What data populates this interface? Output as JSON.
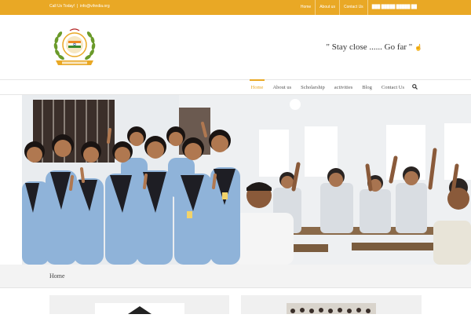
{
  "topbar": {
    "phone_label": "Call Us Today!",
    "email": "info@vihndia.org",
    "links": [
      "Home",
      "About us",
      "Contact Us",
      "███ █████ █████ ██"
    ]
  },
  "header": {
    "tagline": "\" Stay close ...... Go far \"",
    "tagline_icon": "hand-pointer-icon"
  },
  "nav": {
    "items": [
      "Home",
      "About us",
      "Scholarship",
      "activities",
      "Blog",
      "Contact Us"
    ],
    "active_index": 0,
    "search_icon": "search-icon"
  },
  "breadcrumb": {
    "label": "Home"
  },
  "colors": {
    "accent": "#e9a825",
    "uniform": "#8fb3d9",
    "topbar_text": "#ffffff"
  }
}
